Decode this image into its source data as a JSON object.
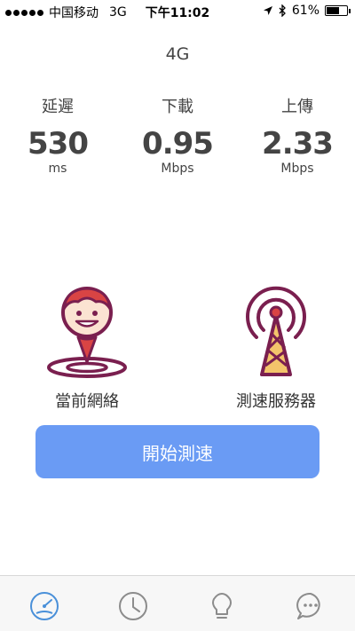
{
  "status_bar": {
    "carrier": "中国移动",
    "network": "3G",
    "time": "下午11:02",
    "battery": "61%"
  },
  "network_type": "4G",
  "metrics": [
    {
      "label": "延遲",
      "value": "530",
      "unit": "ms"
    },
    {
      "label": "下載",
      "value": "0.95",
      "unit": "Mbps"
    },
    {
      "label": "上傳",
      "value": "2.33",
      "unit": "Mbps"
    }
  ],
  "endpoints": {
    "current_network": "當前網絡",
    "test_server": "測速服務器"
  },
  "start_button": "開始測速",
  "tabs": [
    {
      "icon": "speedometer-icon",
      "active": true
    },
    {
      "icon": "clock-icon",
      "active": false
    },
    {
      "icon": "lightbulb-icon",
      "active": false
    },
    {
      "icon": "chat-icon",
      "active": false
    }
  ],
  "colors": {
    "accent": "#6a9bf4",
    "tab_active": "#4a90d9",
    "icon_maroon": "#7a1f4f",
    "icon_red": "#d94444"
  }
}
